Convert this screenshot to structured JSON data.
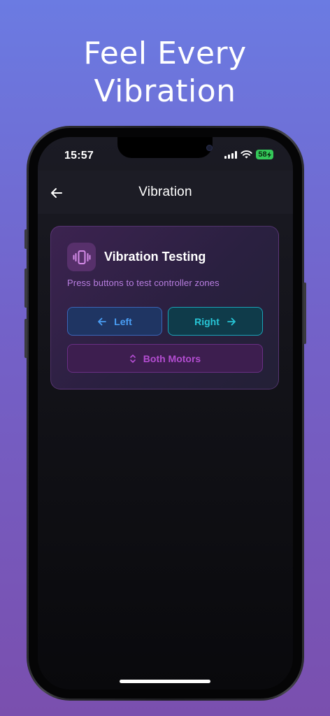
{
  "headline": {
    "line1": "Feel Every",
    "line2": "Vibration"
  },
  "status_bar": {
    "time": "15:57",
    "battery": "58"
  },
  "navbar": {
    "title": "Vibration",
    "back_icon": "arrow-left-icon"
  },
  "card": {
    "icon": "vibration-phone-icon",
    "title": "Vibration Testing",
    "subtitle": "Press buttons to test controller zones"
  },
  "buttons": {
    "left": {
      "label": "Left",
      "icon": "arrow-left-icon"
    },
    "right": {
      "label": "Right",
      "icon": "arrow-right-icon"
    },
    "both": {
      "label": "Both Motors",
      "icon": "chevrons-up-down-icon"
    }
  },
  "colors": {
    "left_accent": "#4a9ef5",
    "right_accent": "#27c5d6",
    "both_accent": "#b34dd1",
    "subtitle": "#b87ee0",
    "battery": "#34c759"
  }
}
